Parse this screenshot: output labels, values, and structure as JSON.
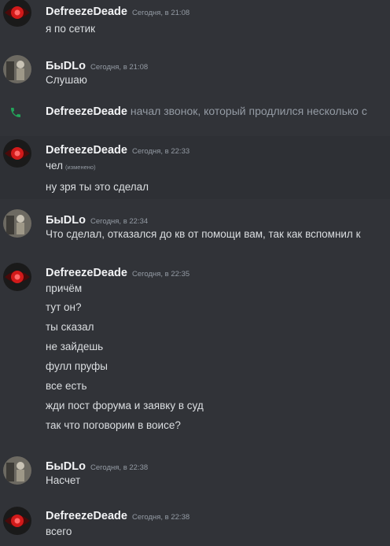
{
  "messages": [
    {
      "author": "DefreezeDeade",
      "timestamp": "Сегодня, в 21:08",
      "lines": [
        "я по сетик"
      ]
    },
    {
      "author": "БыDLo",
      "timestamp": "Сегодня, в 21:08",
      "lines": [
        "Слушаю"
      ]
    },
    {
      "call_author": "DefreezeDeade",
      "call_text": "начал звонок, который продлился несколько с"
    },
    {
      "author": "DefreezeDeade",
      "timestamp": "Сегодня, в 22:33",
      "lines": [
        "чел",
        "ну зря ты это сделал"
      ],
      "edited_label": "(изменено)"
    },
    {
      "author": "БыDLo",
      "timestamp": "Сегодня, в 22:34",
      "lines": [
        "Что сделал, отказался до кв от помощи вам, так как вспомнил к"
      ]
    },
    {
      "author": "DefreezeDeade",
      "timestamp": "Сегодня, в 22:35",
      "lines": [
        "причём",
        "тут он?",
        "ты сказал",
        "не зайдешь",
        "фулл пруфы",
        "все есть",
        "жди пост форума и заявку в суд",
        "так что поговорим в воисе?"
      ]
    },
    {
      "author": "БыDLo",
      "timestamp": "Сегодня, в 22:38",
      "lines": [
        "Насчет"
      ]
    },
    {
      "author": "DefreezeDeade",
      "timestamp": "Сегодня, в 22:38",
      "lines": [
        "всего"
      ]
    }
  ],
  "icons": {
    "call": "phone-icon",
    "avatar_defreeze": "red-eye-avatar",
    "avatar_bydlo": "gray-figure-avatar"
  },
  "colors": {
    "background": "#313338",
    "author": "#f2f3f5",
    "text": "#dbdee1",
    "muted": "#949ba4",
    "call_green": "#23a55a"
  }
}
